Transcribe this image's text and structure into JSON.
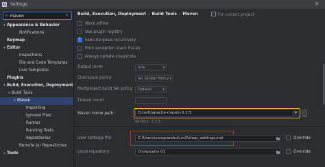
{
  "window": {
    "title": "Settings",
    "app_icon_letter": "IJ"
  },
  "search": {
    "value": "maven",
    "placeholder": ""
  },
  "tree": {
    "appearance": "Appearance & Behavior",
    "notifications": "Notifications",
    "keymap": "Keymap",
    "editor": "Editor",
    "inspections": "Inspections",
    "file_code_templates": "File and Code Templates",
    "live_templates": "Live Templates",
    "plugins": "Plugins",
    "build_exec": "Build, Execution, Deployment",
    "build_tools": "Build Tools",
    "maven": "Maven",
    "importing": "Importing",
    "ignored_files": "Ignored Files",
    "runner": "Runner",
    "running_tests": "Running Tests",
    "repositories": "Repositories",
    "remote_jar": "Remote Jar Repositories",
    "tools": "Tools"
  },
  "breadcrumb": {
    "part1": "Build, Execution, Deployment",
    "part2": "Build Tools",
    "part3": "Maven",
    "for_current": "For current project"
  },
  "options": {
    "work_offline": "Work offline",
    "use_plugin_registry": "Use plugin registry",
    "execute_goals": "Execute goals recursively",
    "print_stack": "Print exception stack traces",
    "always_update": "Always update snapshots"
  },
  "fields": {
    "output_level_label": "Output level:",
    "output_level_value": "Info",
    "checksum_label": "Checksum policy:",
    "checksum_value": "No Global Policy",
    "multiproject_label": "Multiproject build fail policy:",
    "multiproject_value": "Default",
    "thread_count_label": "Thread count",
    "thread_count_value": "",
    "maven_home_label": "Maven home path:",
    "maven_home_value": "D:/soft/apache-maven-3.2.5",
    "version_text": "Version: 3.2.5",
    "user_settings_label": "User settings file:",
    "user_settings_value": "C:\\Users\\yangxiaohui\\.m2\\shop_settings.xml",
    "local_repo_label": "Local repository:",
    "local_repo_value": "D:\\repoaity 01",
    "override_label": "Override"
  },
  "colors": {
    "accent": "#3574f0",
    "selected_row": "#2e436e",
    "highlight_red": "#e02020",
    "highlight_yellow": "#d9b43a"
  }
}
